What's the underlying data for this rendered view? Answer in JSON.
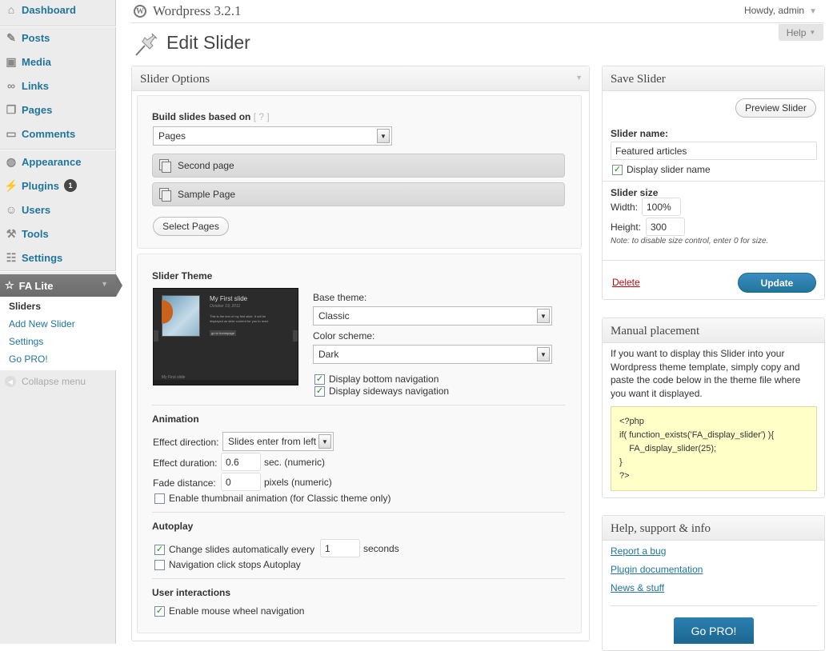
{
  "sidebar": {
    "items": [
      {
        "label": "Dashboard",
        "icon": "dashboard-icon"
      },
      {
        "label": "Posts",
        "icon": "pin-icon"
      },
      {
        "label": "Media",
        "icon": "media-icon"
      },
      {
        "label": "Links",
        "icon": "link-icon"
      },
      {
        "label": "Pages",
        "icon": "pages-icon"
      },
      {
        "label": "Comments",
        "icon": "comment-icon"
      },
      {
        "label": "Appearance",
        "icon": "appearance-icon"
      },
      {
        "label": "Plugins",
        "icon": "plugin-icon",
        "badge": "1"
      },
      {
        "label": "Users",
        "icon": "users-icon"
      },
      {
        "label": "Tools",
        "icon": "tools-icon"
      },
      {
        "label": "Settings",
        "icon": "settings-icon"
      }
    ],
    "fa_lite": {
      "label": "FA Lite",
      "sub": [
        "Sliders",
        "Add New Slider",
        "Settings",
        "Go PRO!"
      ]
    },
    "collapse": "Collapse menu"
  },
  "header": {
    "site_title": "Wordpress 3.2.1",
    "howdy": "Howdy, admin",
    "help": "Help",
    "page_title": "Edit Slider"
  },
  "slider_options": {
    "title": "Slider Options",
    "build_label": "Build slides based on",
    "build_help": "[ ? ]",
    "build_value": "Pages",
    "pages": [
      "Second page",
      "Sample Page"
    ],
    "select_pages": "Select Pages",
    "theme": {
      "heading": "Slider Theme",
      "preview": {
        "slide_title": "My First slide",
        "date": "October 19, 2011",
        "text": "This is the text of my first slide. It will be displayed as slide content for you to read.",
        "button": "go to homepage",
        "footer": "My First slide"
      },
      "base_label": "Base theme:",
      "base_value": "Classic",
      "color_label": "Color scheme:",
      "color_value": "Dark",
      "bottom_nav": "Display bottom navigation",
      "side_nav": "Display sideways navigation"
    },
    "animation": {
      "heading": "Animation",
      "dir_label": "Effect direction:",
      "dir_value": "Slides enter from left",
      "dur_label": "Effect duration:",
      "dur_value": "0.6",
      "dur_unit": "sec. (numeric)",
      "fade_label": "Fade distance:",
      "fade_value": "0",
      "fade_unit": "pixels (numeric)",
      "thumb_anim": "Enable thumbnail animation (for Classic theme only)"
    },
    "autoplay": {
      "heading": "Autoplay",
      "change_label": "Change slides automatically every",
      "change_value": "1",
      "change_unit": "seconds",
      "nav_stop": "Navigation click stops Autoplay"
    },
    "interactions": {
      "heading": "User interactions",
      "mouse_wheel": "Enable mouse wheel navigation"
    }
  },
  "save_slider": {
    "title": "Save Slider",
    "preview": "Preview Slider",
    "name_label": "Slider name:",
    "name_value": "Featured articles",
    "display_name": "Display slider name",
    "size_label": "Slider size",
    "width_label": "Width:",
    "width_value": "100%",
    "height_label": "Height:",
    "height_value": "300",
    "note": "Note: to disable size control, enter 0 for size.",
    "delete": "Delete",
    "update": "Update"
  },
  "manual": {
    "title": "Manual placement",
    "text": "If you want to display this Slider into your Wordpress theme template, simply copy and paste the code below in the theme file where you want it displayed.",
    "code": "<?php\nif( function_exists('FA_display_slider') ){\n    FA_display_slider(25);\n}\n?>"
  },
  "help_box": {
    "title": "Help, support & info",
    "links": [
      "Report a bug",
      "Plugin documentation",
      "News & stuff"
    ],
    "gopro": "Go PRO!"
  },
  "colors": {
    "link": "#21759b",
    "update_button": "#21759b",
    "delete": "#bc0b0b",
    "code_bg": "#ffffc8"
  }
}
